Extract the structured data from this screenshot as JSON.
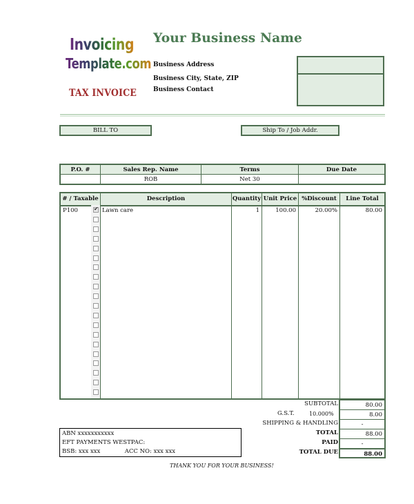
{
  "header": {
    "logo_line1": "Invoicing",
    "logo_line2": "Template.com",
    "document_type": "TAX INVOICE",
    "business_name": "Your Business Name",
    "business_address": "Business Address",
    "business_city_state_zip": "Business City, State, ZIP",
    "business_contact": "Business Contact"
  },
  "colors": {
    "accent_green": "#4e6e50",
    "fill_green": "#e2ede2",
    "business_name_green": "#4a7a52",
    "tax_invoice_red": "#a23030"
  },
  "addresses": {
    "bill_to_label": "BILL TO",
    "ship_to_label": "Ship To / Job Addr."
  },
  "order_info": {
    "headers": [
      "P.O. #",
      "Sales Rep. Name",
      "Terms",
      "Due Date"
    ],
    "values": [
      "",
      "ROB",
      "Net 30",
      ""
    ]
  },
  "items": {
    "headers": {
      "number_taxable": "# / Taxable",
      "description": "Description",
      "quantity": "Quantity",
      "unit_price": "Unit Price",
      "discount": "%Discount",
      "line_total": "Line Total"
    },
    "rows": [
      {
        "number": "P100",
        "taxable": true,
        "description": "Lawn care",
        "quantity": "1",
        "unit_price": "100.00",
        "discount": "20.00%",
        "line_total": "80.00"
      },
      {
        "number": "",
        "taxable": false,
        "description": "",
        "quantity": "",
        "unit_price": "",
        "discount": "",
        "line_total": ""
      },
      {
        "number": "",
        "taxable": false,
        "description": "",
        "quantity": "",
        "unit_price": "",
        "discount": "",
        "line_total": ""
      },
      {
        "number": "",
        "taxable": false,
        "description": "",
        "quantity": "",
        "unit_price": "",
        "discount": "",
        "line_total": ""
      },
      {
        "number": "",
        "taxable": false,
        "description": "",
        "quantity": "",
        "unit_price": "",
        "discount": "",
        "line_total": ""
      },
      {
        "number": "",
        "taxable": false,
        "description": "",
        "quantity": "",
        "unit_price": "",
        "discount": "",
        "line_total": ""
      },
      {
        "number": "",
        "taxable": false,
        "description": "",
        "quantity": "",
        "unit_price": "",
        "discount": "",
        "line_total": ""
      },
      {
        "number": "",
        "taxable": false,
        "description": "",
        "quantity": "",
        "unit_price": "",
        "discount": "",
        "line_total": ""
      },
      {
        "number": "",
        "taxable": false,
        "description": "",
        "quantity": "",
        "unit_price": "",
        "discount": "",
        "line_total": ""
      },
      {
        "number": "",
        "taxable": false,
        "description": "",
        "quantity": "",
        "unit_price": "",
        "discount": "",
        "line_total": ""
      },
      {
        "number": "",
        "taxable": false,
        "description": "",
        "quantity": "",
        "unit_price": "",
        "discount": "",
        "line_total": ""
      },
      {
        "number": "",
        "taxable": false,
        "description": "",
        "quantity": "",
        "unit_price": "",
        "discount": "",
        "line_total": ""
      },
      {
        "number": "",
        "taxable": false,
        "description": "",
        "quantity": "",
        "unit_price": "",
        "discount": "",
        "line_total": ""
      },
      {
        "number": "",
        "taxable": false,
        "description": "",
        "quantity": "",
        "unit_price": "",
        "discount": "",
        "line_total": ""
      },
      {
        "number": "",
        "taxable": false,
        "description": "",
        "quantity": "",
        "unit_price": "",
        "discount": "",
        "line_total": ""
      },
      {
        "number": "",
        "taxable": false,
        "description": "",
        "quantity": "",
        "unit_price": "",
        "discount": "",
        "line_total": ""
      },
      {
        "number": "",
        "taxable": false,
        "description": "",
        "quantity": "",
        "unit_price": "",
        "discount": "",
        "line_total": ""
      },
      {
        "number": "",
        "taxable": false,
        "description": "",
        "quantity": "",
        "unit_price": "",
        "discount": "",
        "line_total": ""
      },
      {
        "number": "",
        "taxable": false,
        "description": "",
        "quantity": "",
        "unit_price": "",
        "discount": "",
        "line_total": ""
      },
      {
        "number": "",
        "taxable": false,
        "description": "",
        "quantity": "",
        "unit_price": "",
        "discount": "",
        "line_total": ""
      }
    ]
  },
  "totals": {
    "subtotal_label": "SUBTOTAL",
    "subtotal_value": "80.00",
    "gst_label": "G.S.T.",
    "gst_rate": "10.000%",
    "gst_value": "8.00",
    "shipping_label": "SHIPPING & HANDLING",
    "shipping_value": "-",
    "total_label": "TOTAL",
    "total_value": "88.00",
    "paid_label": "PAID",
    "paid_value": "-",
    "total_due_label": "TOTAL DUE",
    "total_due_value": "88.00"
  },
  "payment": {
    "abn": "ABN xxxxxxxxxxx",
    "eft": "EFT PAYMENTS WESTPAC:",
    "bsb": "BSB: xxx xxx",
    "acc": "ACC NO: xxx xxx"
  },
  "footer": {
    "thanks": "THANK YOU FOR YOUR BUSINESS!"
  }
}
